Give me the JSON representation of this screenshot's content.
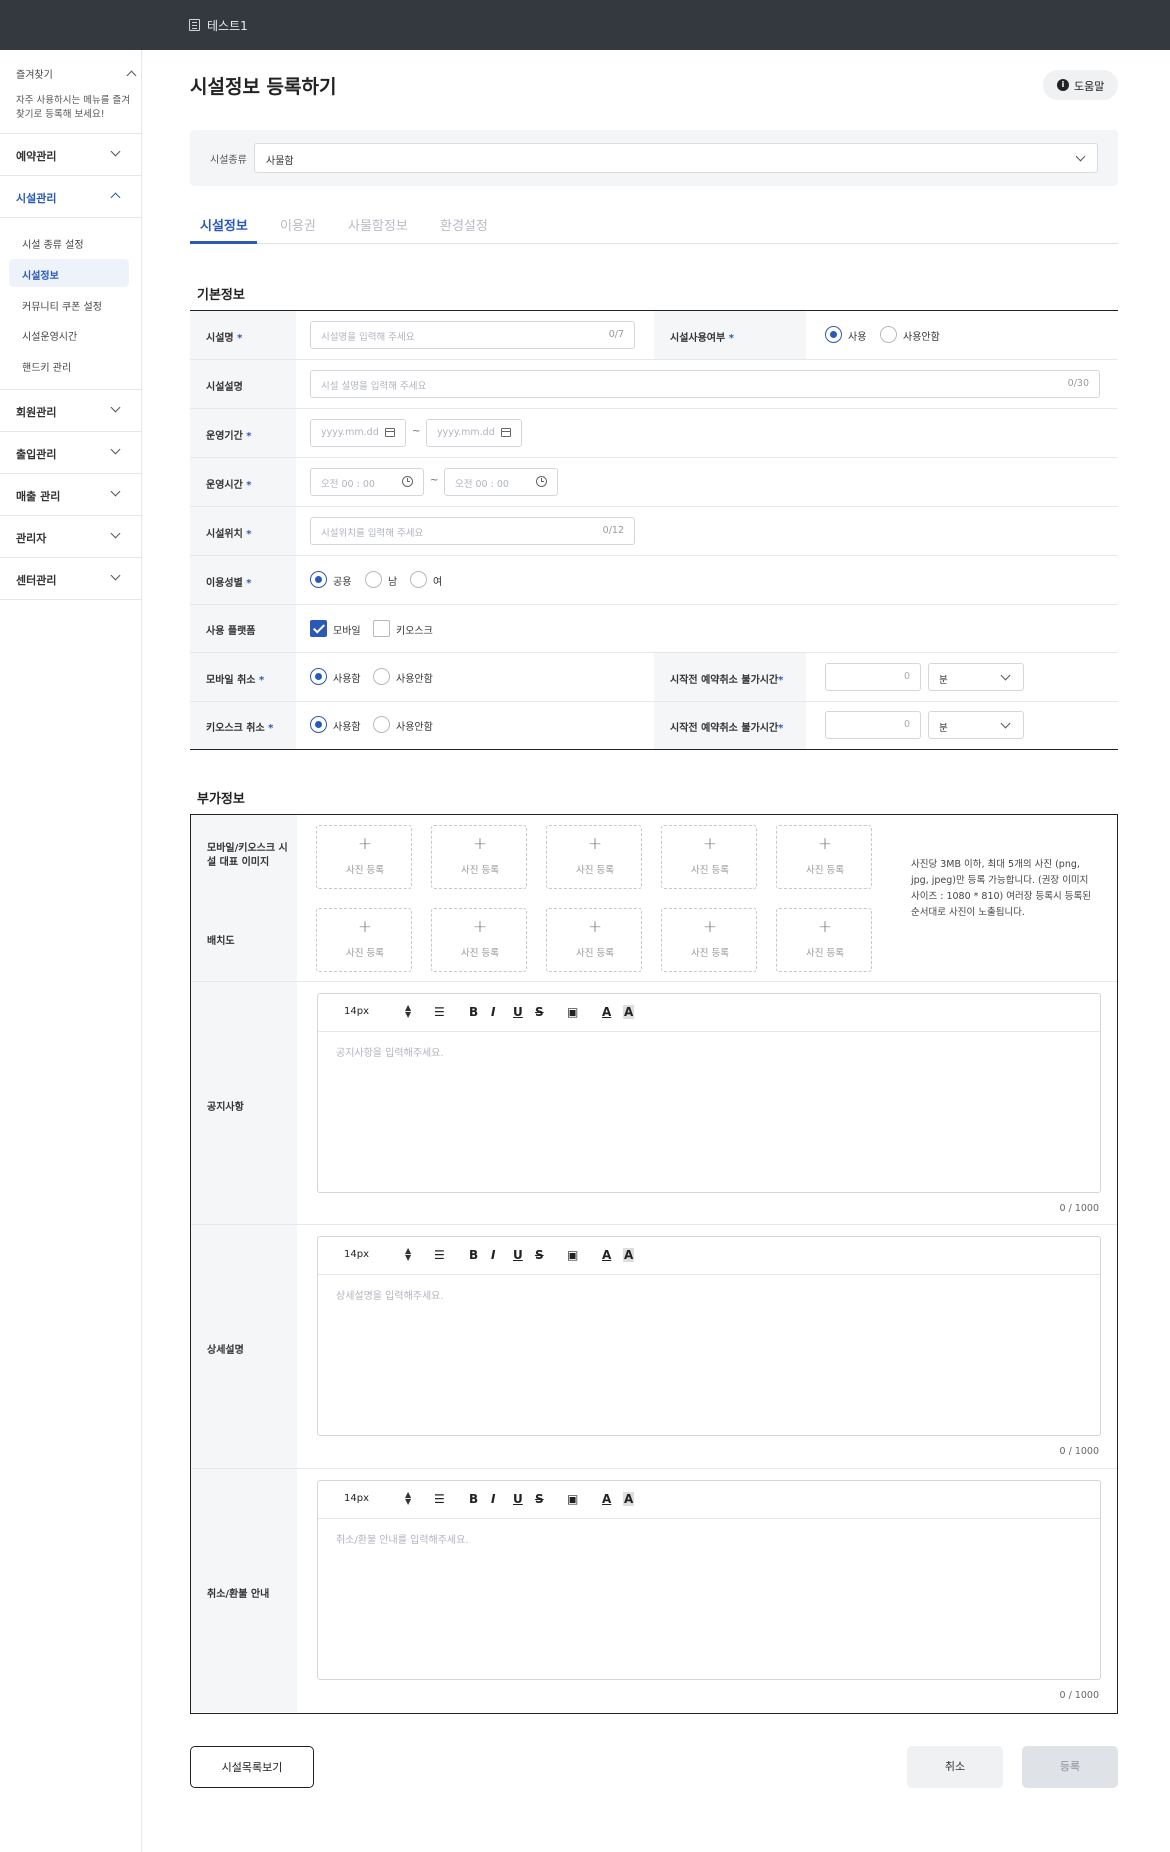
{
  "topbar": {
    "title": "테스트1"
  },
  "sidebar": {
    "favorites": {
      "title": "즐겨찾기",
      "desc": "자주 사용하시는 메뉴를 즐겨찾기로 등록해 보세요!"
    },
    "menus": [
      {
        "label": "예약관리"
      },
      {
        "label": "시설관리"
      },
      {
        "label": "회원관리"
      },
      {
        "label": "출입관리"
      },
      {
        "label": "매출 관리"
      },
      {
        "label": "관리자"
      },
      {
        "label": "센터관리"
      }
    ],
    "submenus": [
      {
        "label": "시설 종류 설정"
      },
      {
        "label": "시설정보"
      },
      {
        "label": "커뮤니티 쿠폰 설정"
      },
      {
        "label": "시설운영시간"
      },
      {
        "label": "핸드키 관리"
      }
    ]
  },
  "page": {
    "title": "시설정보 등록하기",
    "help": "도움말"
  },
  "facility_type": {
    "label": "시설종류",
    "value": "사물함"
  },
  "tabs": [
    {
      "label": "시설정보"
    },
    {
      "label": "이용권"
    },
    {
      "label": "사물함정보"
    },
    {
      "label": "환경설정"
    }
  ],
  "basic": {
    "title": "기본정보",
    "name": {
      "label": "시설명",
      "req": "*",
      "placeholder": "시설명을 입력해 주세요",
      "count": "0/7"
    },
    "usage": {
      "label": "시설사용여부",
      "req": "*",
      "opt1": "사용",
      "opt2": "사용안함"
    },
    "desc": {
      "label": "시설설명",
      "placeholder": "시설 설명을 입력해 주세요",
      "count": "0/30"
    },
    "period": {
      "label": "운영기간",
      "req": "*",
      "start": "yyyy.mm.dd",
      "end": "yyyy.mm.dd",
      "sep": "~"
    },
    "time": {
      "label": "운영시간",
      "req": "*",
      "start": "오전 00 : 00",
      "end": "오전 00 : 00",
      "sep": "~"
    },
    "location": {
      "label": "시설위치",
      "req": "*",
      "placeholder": "시설위치를 입력해 주세요",
      "count": "0/12"
    },
    "gender": {
      "label": "이용성별",
      "req": "*",
      "opt1": "공용",
      "opt2": "남",
      "opt3": "여"
    },
    "platform": {
      "label": "사용 플랫폼",
      "opt1": "모바일",
      "opt2": "키오스크"
    },
    "mobile_cancel": {
      "label": "모바일 취소",
      "req": "*",
      "opt1": "사용함",
      "opt2": "사용안함",
      "label2": "시작전 예약취소 불가시간",
      "value": "0",
      "unit": "분"
    },
    "kiosk_cancel": {
      "label": "키오스크 취소",
      "req": "*",
      "opt1": "사용함",
      "opt2": "사용안함",
      "label2": "시작전 예약취소 불가시간",
      "value": "0",
      "unit": "분"
    }
  },
  "extra": {
    "title": "부가정보",
    "rep_image_label": "모바일/키오스크 시설 대표 이미지",
    "layout_label": "배치도",
    "photo_label": "사진 등록",
    "photo_note": "사진당 3MB 이하, 최대 5개의 사진 (png, jpg, jpeg)만 등록 가능합니다. (권장 이미지 사이즈 : 1080 * 810) 여러장 등록시 등록된 순서대로 사진이 노출됩니다.",
    "font_size": "14px",
    "notice": {
      "label": "공지사항",
      "placeholder": "공지사항을 입력해주세요.",
      "count": "0 / 1000"
    },
    "detail": {
      "label": "상세설명",
      "placeholder": "상세설명을 입력해주세요.",
      "count": "0 / 1000"
    },
    "refund": {
      "label": "취소/환불 안내",
      "placeholder": "취소/환불 안내를 입력해주세요.",
      "count": "0 / 1000"
    }
  },
  "buttons": {
    "list": "시설목록보기",
    "cancel": "취소",
    "submit": "등록"
  },
  "colors": {
    "accent": "#2a59b7",
    "topbar": "#34383f"
  }
}
